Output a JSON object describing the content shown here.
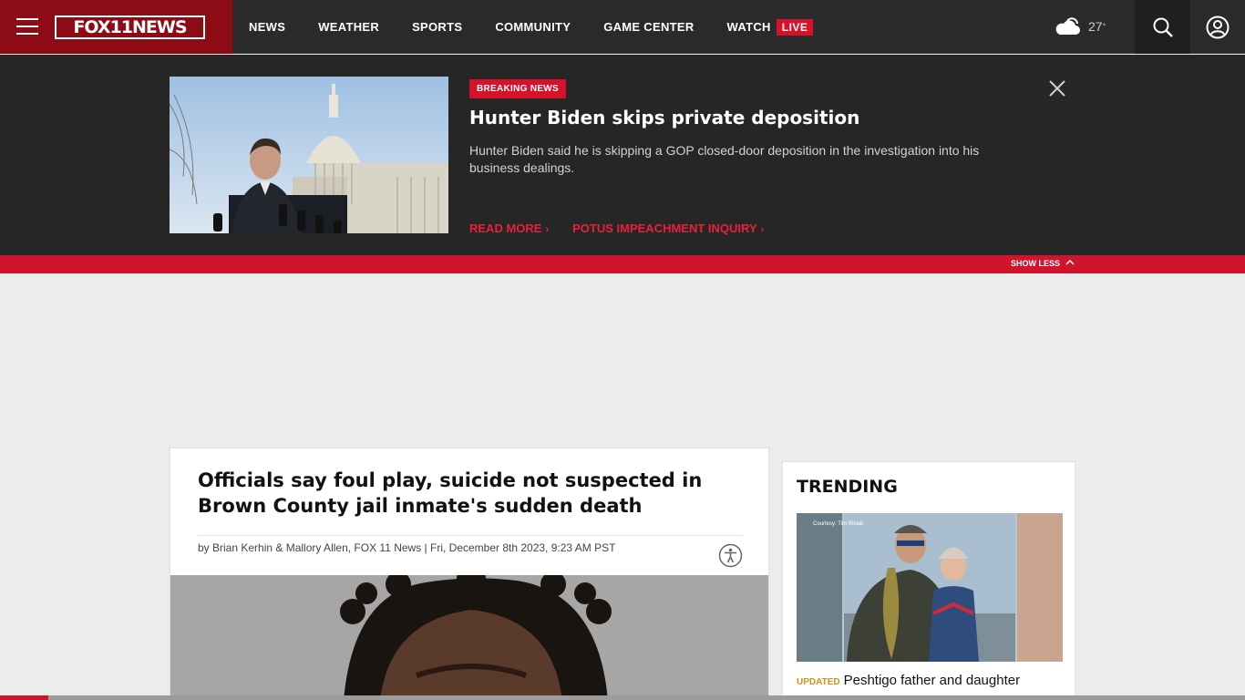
{
  "header": {
    "logo_text": "FOX11NEWS",
    "nav_items": [
      "NEWS",
      "WEATHER",
      "SPORTS",
      "COMMUNITY",
      "GAME CENTER",
      "WATCH"
    ],
    "live_badge": "LIVE",
    "weather": {
      "temp": "27",
      "unit": "°",
      "icon": "partly-cloudy-icon"
    },
    "icons": {
      "menu": "hamburger-menu-icon",
      "search": "search-icon",
      "account": "user-account-icon"
    }
  },
  "breaking_news": {
    "label": "BREAKING NEWS",
    "title": "Hunter Biden skips private deposition",
    "description": "Hunter Biden said he is skipping a GOP closed-door deposition in the investigation into his business dealings.",
    "links": [
      "READ MORE",
      "POTUS IMPEACHMENT INQUIRY"
    ],
    "show_less": "SHOW LESS"
  },
  "article": {
    "title": "Officials say foul play, suicide not suspected in Brown County jail inmate's sudden death",
    "byline": "by Brian Kerhin & Mallory Allen, FOX 11 News | Fri, December 8th 2023, 9:23 AM PST"
  },
  "trending": {
    "heading": "TRENDING",
    "image_caption": "Courtesy: Tim Wolak",
    "items": [
      {
        "badge": "UPDATED",
        "text": "Peshtigo father and daughter"
      }
    ]
  },
  "scroll_progress": {
    "fraction": 0.039
  },
  "colors": {
    "brand_red": "#d0142d",
    "brand_dark_red": "#8c0b14",
    "nav_bg": "#2a2a2a",
    "updated_gold": "#d19412"
  }
}
